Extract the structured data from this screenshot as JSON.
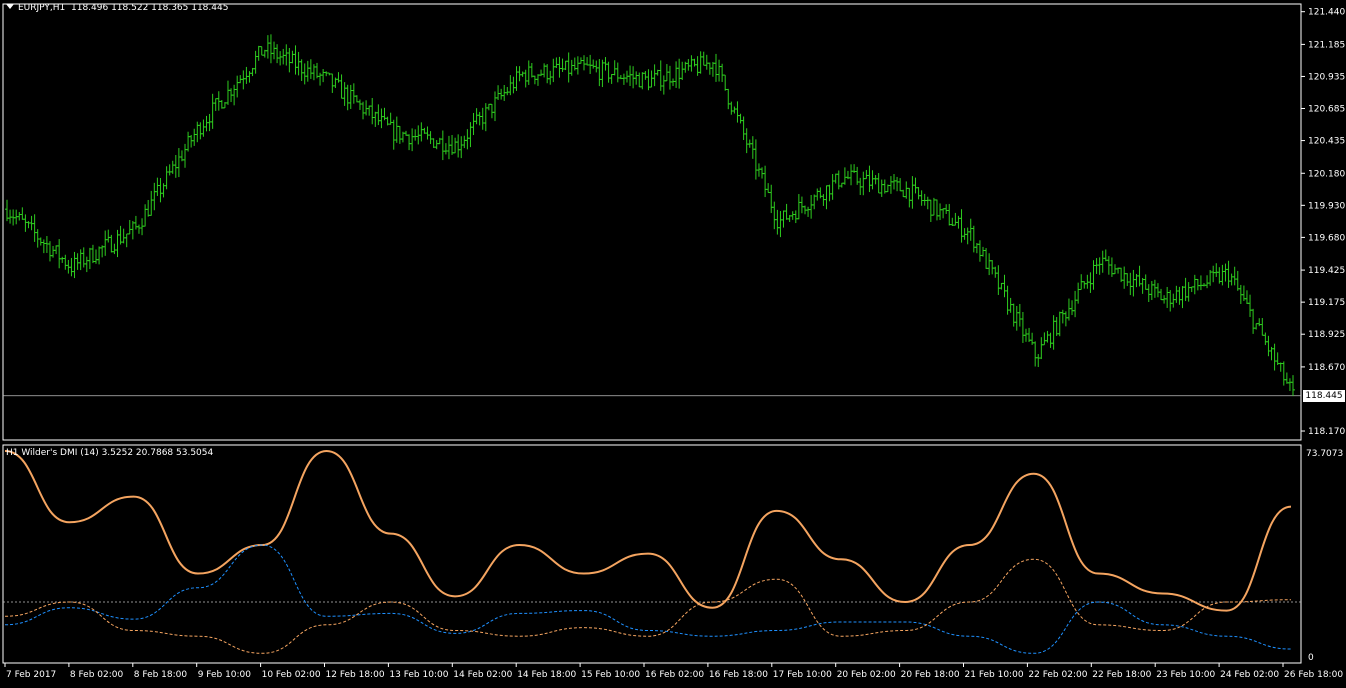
{
  "header": {
    "symbol": "EURJPY,H1",
    "ohlc": "118.496 118.522 118.365 118.445"
  },
  "indicator": {
    "label": "H1 Wilder's DMI (14) 3.5252 20.7868 53.5054",
    "scale_max": "73.7073",
    "scale_min": "0"
  },
  "current_price": "118.445",
  "price_axis": [
    "121.440",
    "121.185",
    "120.935",
    "120.685",
    "120.435",
    "120.180",
    "119.930",
    "119.680",
    "119.425",
    "119.175",
    "118.925",
    "118.670",
    "118.170"
  ],
  "time_axis": [
    "7 Feb 2017",
    "8 Feb 02:00",
    "8 Feb 18:00",
    "9 Feb 10:00",
    "10 Feb 02:00",
    "12 Feb 18:00",
    "13 Feb 10:00",
    "14 Feb 02:00",
    "14 Feb 18:00",
    "15 Feb 10:00",
    "16 Feb 02:00",
    "16 Feb 18:00",
    "17 Feb 10:00",
    "20 Feb 02:00",
    "20 Feb 18:00",
    "21 Feb 10:00",
    "22 Feb 02:00",
    "22 Feb 18:00",
    "23 Feb 10:00",
    "24 Feb 02:00",
    "26 Feb 18:00"
  ],
  "colors": {
    "background": "#000000",
    "bars": "#2ecc1f",
    "adx": "#f4a460",
    "plus_di": "#1e90ff",
    "minus_di": "#f4a460",
    "grid": "#c0c0c0"
  },
  "chart_data": [
    {
      "type": "line",
      "title": "EURJPY,H1",
      "series_kind": "ohlc-bars",
      "ylim": [
        118.1,
        121.5
      ],
      "x": [
        "7 Feb 2017",
        "8 Feb 02:00",
        "8 Feb 18:00",
        "9 Feb 10:00",
        "10 Feb 02:00",
        "12 Feb 18:00",
        "13 Feb 10:00",
        "14 Feb 02:00",
        "14 Feb 18:00",
        "15 Feb 10:00",
        "16 Feb 02:00",
        "16 Feb 18:00",
        "17 Feb 10:00",
        "20 Feb 02:00",
        "20 Feb 18:00",
        "21 Feb 10:00",
        "22 Feb 02:00",
        "22 Feb 18:00",
        "23 Feb 10:00",
        "24 Feb 02:00",
        "26 Feb 18:00"
      ],
      "series": [
        {
          "values": [
            119.9,
            119.45,
            119.75,
            120.55,
            121.15,
            120.9,
            120.5,
            120.4,
            120.95,
            121.0,
            120.9,
            121.05,
            119.8,
            120.15,
            120.05,
            119.7,
            118.75,
            119.5,
            119.2,
            119.4,
            118.45
          ]
        }
      ]
    },
    {
      "type": "line",
      "title": "H1 Wilder's DMI (14) 3.5252 20.7868 53.5054",
      "ylim": [
        0,
        73.7073
      ],
      "x": [
        "7 Feb 2017",
        "8 Feb 02:00",
        "8 Feb 18:00",
        "9 Feb 10:00",
        "10 Feb 02:00",
        "12 Feb 18:00",
        "13 Feb 10:00",
        "14 Feb 02:00",
        "14 Feb 18:00",
        "15 Feb 10:00",
        "16 Feb 02:00",
        "16 Feb 18:00",
        "17 Feb 10:00",
        "20 Feb 02:00",
        "20 Feb 18:00",
        "21 Feb 10:00",
        "22 Feb 02:00",
        "22 Feb 18:00",
        "23 Feb 10:00",
        "24 Feb 02:00",
        "26 Feb 18:00"
      ],
      "series": [
        {
          "values": [
            73,
            48,
            57,
            30,
            40,
            73,
            44,
            22,
            40,
            30,
            37,
            18,
            52,
            35,
            20,
            40,
            65,
            30,
            23,
            17,
            53.5
          ]
        },
        {
          "values": [
            12,
            18,
            14,
            25,
            40,
            15,
            16,
            9,
            16,
            17,
            10,
            8,
            10,
            13,
            13,
            8,
            2,
            20,
            12,
            8,
            3.5
          ]
        },
        {
          "values": [
            15,
            20,
            10,
            8,
            2,
            12,
            20,
            10,
            8,
            11,
            8,
            20,
            28,
            8,
            10,
            20,
            35,
            12,
            10,
            20,
            20.8
          ]
        }
      ],
      "reference_line": 20
    }
  ]
}
